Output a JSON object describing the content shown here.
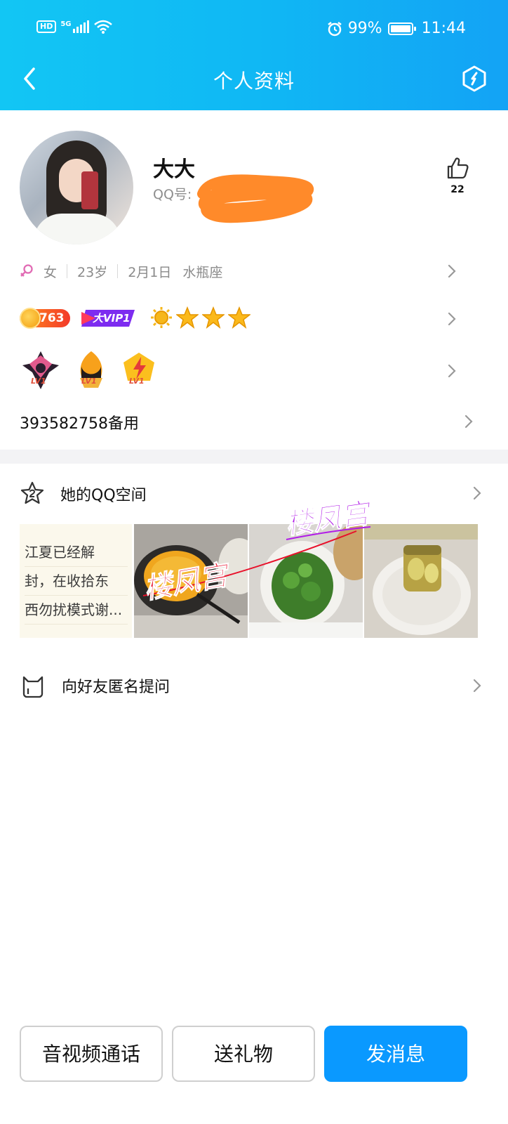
{
  "status_bar": {
    "hd": "HD",
    "net": "5G",
    "battery": "99%",
    "battery_level": 0.99,
    "time": "11:44"
  },
  "header": {
    "title": "个人资料",
    "back_icon": "chevron-left-icon",
    "action_icon": "hexagon-settings-icon"
  },
  "profile": {
    "nickname": "大大",
    "qq_label": "QQ号:",
    "likes": "22",
    "gender": "女",
    "age": "23岁",
    "birthday": "2月1日",
    "constellation": "水瓶座",
    "level": "763",
    "vip": "大VIP1",
    "medal_level": "LV1",
    "remark": "393582758备用"
  },
  "space": {
    "title": "她的QQ空间",
    "post_lines": [
      "江夏已经解",
      "封，在收拾东",
      "西勿扰模式谢..."
    ],
    "watermark": "楼凤宫"
  },
  "ask": {
    "title": "向好友匿名提问"
  },
  "actions": {
    "call": "音视频通话",
    "gift": "送礼物",
    "message": "发消息"
  },
  "colors": {
    "header_start": "#12c6f4",
    "header_end": "#13a3f5",
    "primary": "#0a99ff",
    "scribble": "#ff8a2a",
    "watermark_red": "#e8102a",
    "watermark_purple": "#b11be8"
  }
}
